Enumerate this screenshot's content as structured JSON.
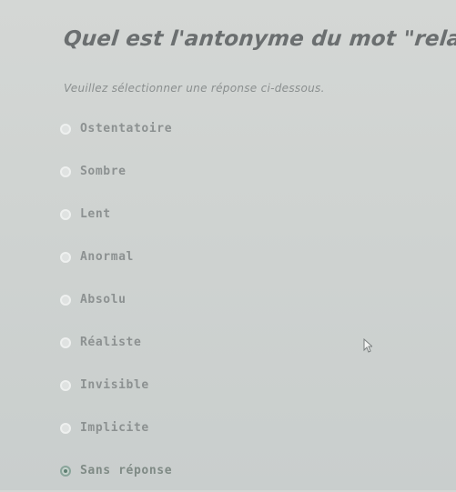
{
  "question": {
    "title": "Quel est l'antonyme du mot \"relatif\" ?",
    "instruction": "Veuillez sélectionner une réponse ci-dessous."
  },
  "options": [
    {
      "label": "Ostentatoire",
      "selected": false
    },
    {
      "label": "Sombre",
      "selected": false
    },
    {
      "label": "Lent",
      "selected": false
    },
    {
      "label": "Anormal",
      "selected": false
    },
    {
      "label": "Absolu",
      "selected": false
    },
    {
      "label": "Réaliste",
      "selected": false
    },
    {
      "label": "Invisible",
      "selected": false
    },
    {
      "label": "Implicite",
      "selected": false
    },
    {
      "label": "Sans réponse",
      "selected": true
    }
  ],
  "colors": {
    "background": "#d0d4d2",
    "text": "#8c9191",
    "selected_accent": "#5f7f72"
  },
  "icons": {
    "cursor": "mouse-pointer-icon"
  }
}
